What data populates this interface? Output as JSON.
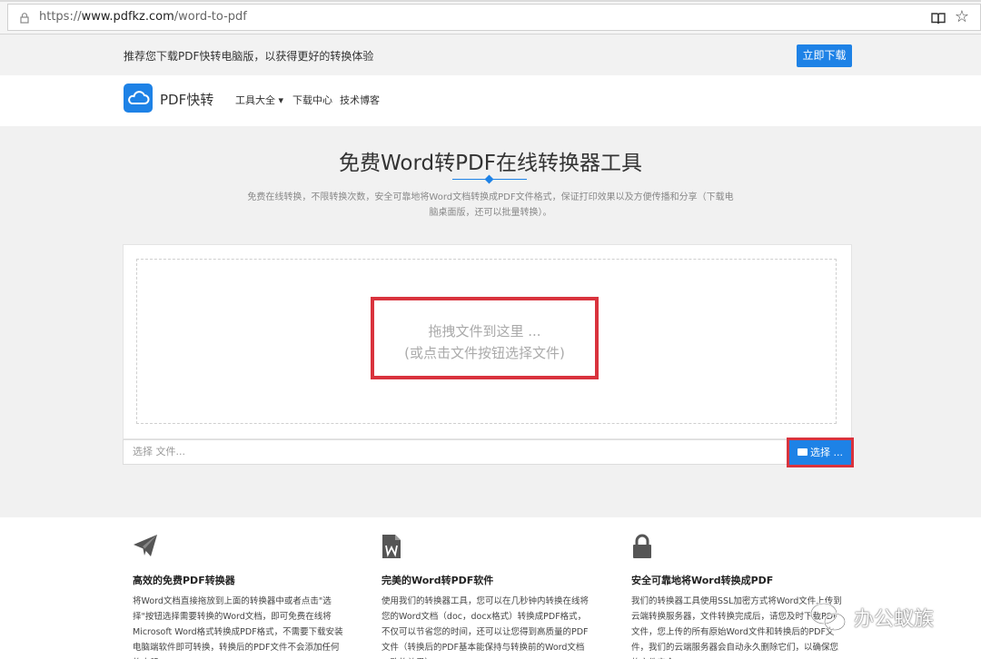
{
  "browser": {
    "url_prefix": "https://",
    "url_host": "www.pdfkz.com",
    "url_path": "/word-to-pdf"
  },
  "promo": {
    "text": "推荐您下载PDF快转电脑版，以获得更好的转换体验",
    "download_label": "立即下载"
  },
  "nav": {
    "logo_text": "PDF快转",
    "items": [
      {
        "label": "工具大全 ▾"
      },
      {
        "label": "下载中心"
      },
      {
        "label": "技术博客"
      }
    ]
  },
  "hero": {
    "title": "免费Word转PDF在线转换器工具",
    "desc": "免费在线转换，不限转换次数，安全可靠地将Word文档转换成PDF文件格式，保证打印效果以及方便传播和分享（下载电脑桌面版，还可以批量转换）。"
  },
  "upload": {
    "drop_line1": "拖拽文件到这里 ...",
    "drop_line2": "(或点击文件按钮选择文件)",
    "file_placeholder": "选择 文件...",
    "select_label": "选择 ..."
  },
  "features": [
    {
      "title": "高效的免费PDF转换器",
      "body": "将Word文档直接拖放到上面的转换器中或者点击\"选择\"按钮选择需要转换的Word文档，即可免费在线将Microsoft Word格式转换成PDF格式，不需要下载安装电脑端软件即可转换，转换后的PDF文件不会添加任何的水印。"
    },
    {
      "title": "完美的Word转PDF软件",
      "body": "使用我们的转换器工具，您可以在几秒钟内转换在线将您的Word文档（doc，docx格式）转换成PDF格式，不仅可以节省您的时间，还可以让您得到高质量的PDF文件（转换后的PDF基本能保持与转换前的Word文档一致的效果）。"
    },
    {
      "title": "安全可靠地将Word转换成PDF",
      "body": "我们的转换器工具使用SSL加密方式将Word文件上传到云端转换服务器，文件转换完成后，请您及时下载PDF文件，您上传的所有原始Word文件和转换后的PDF文件，我们的云端服务器会自动永久删除它们，以确保您的文件安全。"
    }
  ],
  "watermark": {
    "text": "办公蚁族"
  }
}
